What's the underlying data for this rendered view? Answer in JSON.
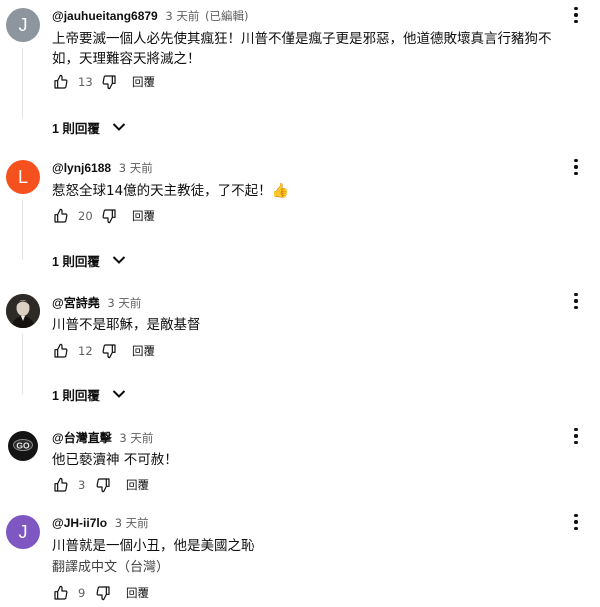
{
  "comments": [
    {
      "avatar_letter": "J",
      "avatar_color": "#8d969e",
      "author": "@jauhueitang6879",
      "time": "3 天前",
      "edited": "(已編輯)",
      "text": "上帝要滅一個人必先使其瘋狂！川普不僅是瘋子更是邪惡，他道德敗壞真言行豬狗不如，天理難容天將滅之！",
      "likes": "13",
      "reply_label": "回覆",
      "replies_label": "1 則回覆"
    },
    {
      "avatar_letter": "L",
      "avatar_color": "#f4511e",
      "author": "@lynj6188",
      "time": "3 天前",
      "text": "惹怒全球14億的天主教徒，了不起！",
      "emoji": "👍",
      "likes": "20",
      "reply_label": "回覆",
      "replies_label": "1 則回覆"
    },
    {
      "avatar_letter": "",
      "avatar_color": "#3a3530",
      "author": "@宮詩堯",
      "time": "3 天前",
      "text": "川普不是耶穌，是敵基督",
      "likes": "12",
      "reply_label": "回覆",
      "replies_label": "1 則回覆"
    },
    {
      "avatar_letter": "",
      "avatar_color": "#111111",
      "avatar_badge": "GO",
      "author": "@台灣直擊",
      "time": "3 天前",
      "text": "他已褻瀆神 不可赦！",
      "likes": "3",
      "reply_label": "回覆"
    },
    {
      "avatar_letter": "J",
      "avatar_color": "#7e57c2",
      "author": "@JH-ii7lo",
      "time": "3 天前",
      "text": "川普就是一個小丑，他是美國之恥",
      "translate": "翻譯成中文（台灣）",
      "likes": "9",
      "reply_label": "回覆"
    }
  ],
  "icons": {
    "like": "thumb-up-icon",
    "dislike": "thumb-down-icon",
    "more": "more-vert-icon",
    "expand": "chevron-down-icon"
  }
}
